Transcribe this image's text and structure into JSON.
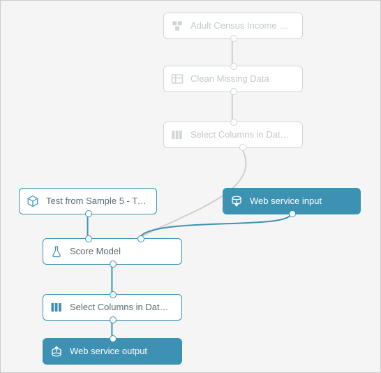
{
  "colors": {
    "accent": "#3d91b3",
    "ghost_border": "#d0d6d9",
    "ghost_text": "#c2c8cc",
    "node_text": "#5a6b74",
    "canvas_bg": "#f5f5f5",
    "canvas_border": "#cccccc"
  },
  "nodes": {
    "dataset": {
      "label": "Adult Census Income Binary C...",
      "icon": "dataset-icon"
    },
    "clean": {
      "label": "Clean Missing Data",
      "icon": "table-icon"
    },
    "select_top": {
      "label": "Select Columns in Dataset",
      "icon": "columns-icon"
    },
    "trained": {
      "label": "Test from Sample 5 - Training...",
      "icon": "cube-icon"
    },
    "ws_input": {
      "label": "Web service input",
      "icon": "ws-in-icon"
    },
    "score": {
      "label": "Score Model",
      "icon": "flask-icon"
    },
    "select_bottom": {
      "label": "Select Columns in Dataset",
      "icon": "columns-icon"
    },
    "ws_output": {
      "label": "Web service output",
      "icon": "ws-out-icon"
    }
  }
}
